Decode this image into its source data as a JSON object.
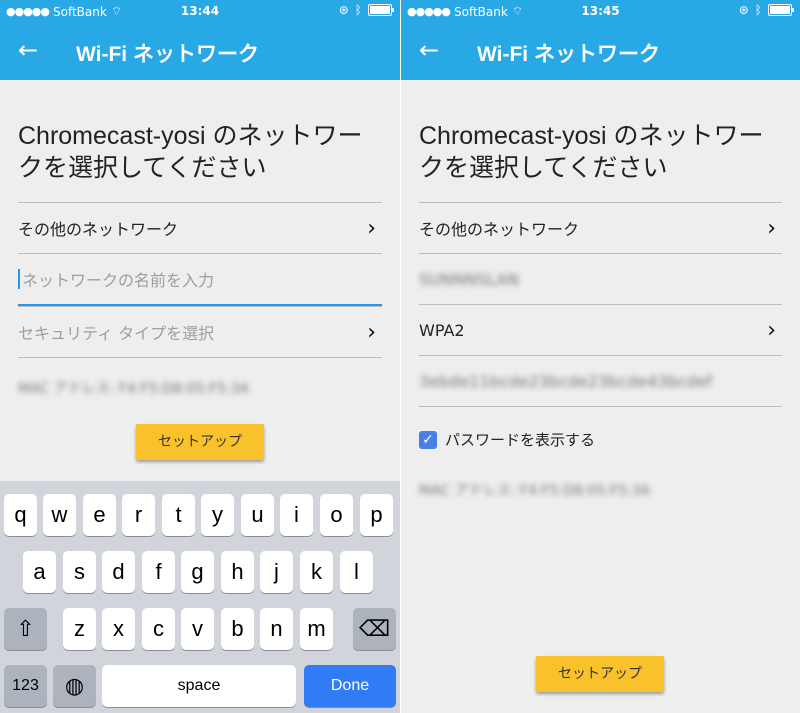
{
  "left": {
    "status": {
      "carrier": "SoftBank",
      "time": "13:44"
    },
    "appbar": {
      "title": "Wi-Fi ネットワーク"
    },
    "heading": "Chromecast-yosi のネットワークを選択してください",
    "other_networks": "その他のネットワーク",
    "name_placeholder": "ネットワークの名前を入力",
    "security_placeholder": "セキュリティ タイプを選択",
    "mac": "MAC アドレス: F4:F5:D8:05:F5:3A",
    "setup": "セットアップ"
  },
  "right": {
    "status": {
      "carrier": "SoftBank",
      "time": "13:45"
    },
    "appbar": {
      "title": "Wi-Fi ネットワーク"
    },
    "heading": "Chromecast-yosi のネットワークを選択してください",
    "other_networks": "その他のネットワーク",
    "ssid": "SUNNNSLAN",
    "security": "WPA2",
    "password": "3ebde11bcde23bcde23bcde43bcdef",
    "show_password": "パスワードを表示する",
    "mac": "MAC アドレス: F4:F5:D8:05:F5:3A",
    "setup": "セットアップ"
  },
  "keyboard": {
    "row1": [
      "q",
      "w",
      "e",
      "r",
      "t",
      "y",
      "u",
      "i",
      "o",
      "p"
    ],
    "row2": [
      "a",
      "s",
      "d",
      "f",
      "g",
      "h",
      "j",
      "k",
      "l"
    ],
    "row3": [
      "z",
      "x",
      "c",
      "v",
      "b",
      "n",
      "m"
    ],
    "numbers": "123",
    "space": "space",
    "done": "Done"
  },
  "colors": {
    "appbar": "#29a8e6",
    "button": "#f9c12a",
    "accent": "#2196f3",
    "done": "#2f7cf6"
  }
}
